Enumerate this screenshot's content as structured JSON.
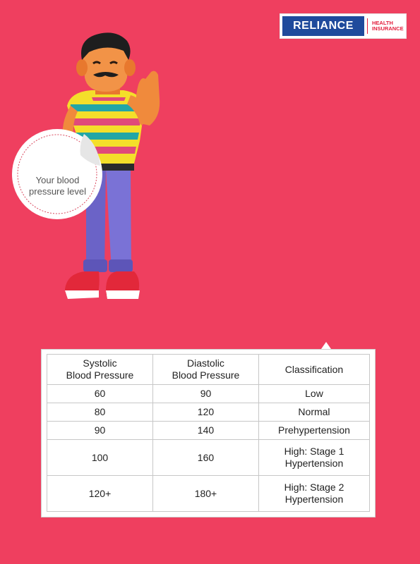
{
  "logo": {
    "brand": "RELIANCE",
    "sub_line1": "HEALTH",
    "sub_line2": "INSURANCE",
    "brand_color": "#1f4a9c",
    "accent_color": "#e31e3c"
  },
  "background_color": "#ef3f5f",
  "sticker": {
    "line1": "Your blood",
    "line2": "pressure level"
  },
  "table": {
    "headers": {
      "col1_line1": "Systolic",
      "col1_line2": "Blood Pressure",
      "col2_line1": "Diastolic",
      "col2_line2": "Blood Pressure",
      "col3": "Classification"
    },
    "rows": [
      {
        "systolic": "60",
        "diastolic": "90",
        "class_line1": "Low",
        "class_line2": ""
      },
      {
        "systolic": "80",
        "diastolic": "120",
        "class_line1": "Normal",
        "class_line2": ""
      },
      {
        "systolic": "90",
        "diastolic": "140",
        "class_line1": "Prehypertension",
        "class_line2": ""
      },
      {
        "systolic": "100",
        "diastolic": "160",
        "class_line1": "High: Stage 1",
        "class_line2": "Hypertension"
      },
      {
        "systolic": "120+",
        "diastolic": "180+",
        "class_line1": "High: Stage 2",
        "class_line2": "Hypertension"
      }
    ]
  }
}
